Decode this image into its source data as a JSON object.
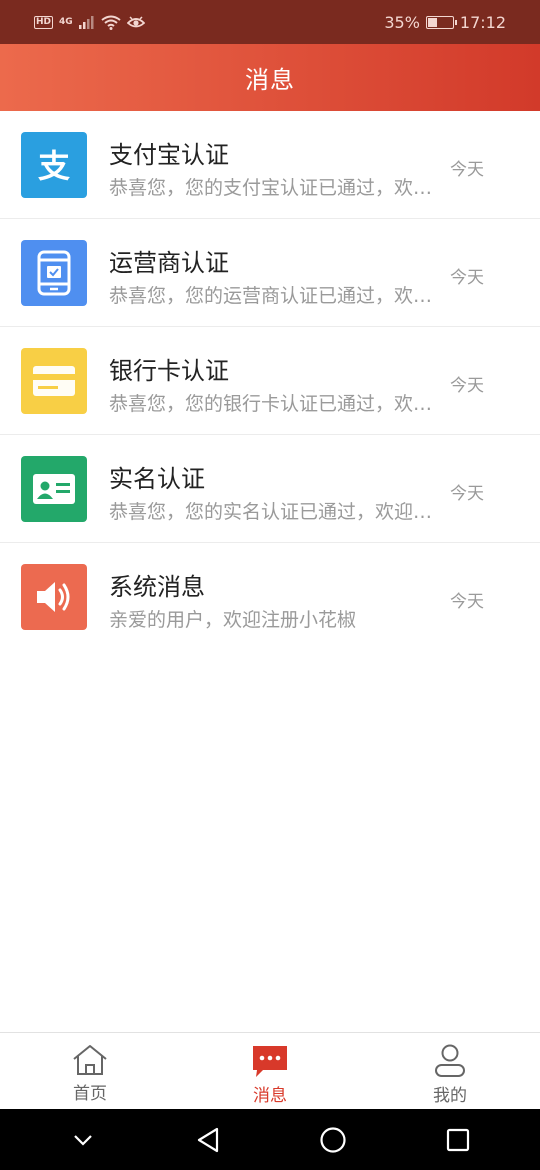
{
  "status_bar": {
    "hd": "HD",
    "network": "4G",
    "battery_percent": "35%",
    "battery_level": 0.35,
    "time": "17:12"
  },
  "header": {
    "title": "消息"
  },
  "messages": [
    {
      "icon": "alipay-icon",
      "icon_color": "#2a9fe0",
      "title": "支付宝认证",
      "desc": "恭喜您，您的支付宝认证已通过，欢迎使用小花椒",
      "time": "今天"
    },
    {
      "icon": "phone-check-icon",
      "icon_color": "#4f8ff0",
      "title": "运营商认证",
      "desc": "恭喜您，您的运营商认证已通过，欢迎使用小花椒",
      "time": "今天"
    },
    {
      "icon": "bank-card-icon",
      "icon_color": "#f8cf45",
      "title": "银行卡认证",
      "desc": "恭喜您，您的银行卡认证已通过，欢迎使用小花椒",
      "time": "今天"
    },
    {
      "icon": "id-card-icon",
      "icon_color": "#23a86a",
      "title": "实名认证",
      "desc": "恭喜您，您的实名认证已通过，欢迎使用小花椒",
      "time": "今天"
    },
    {
      "icon": "speaker-icon",
      "icon_color": "#ec6a50",
      "title": "系统消息",
      "desc": "亲爱的用户，欢迎注册小花椒",
      "time": "今天"
    }
  ],
  "tabbar": {
    "home": "首页",
    "messages": "消息",
    "mine": "我的",
    "active_color": "#d8392a"
  }
}
